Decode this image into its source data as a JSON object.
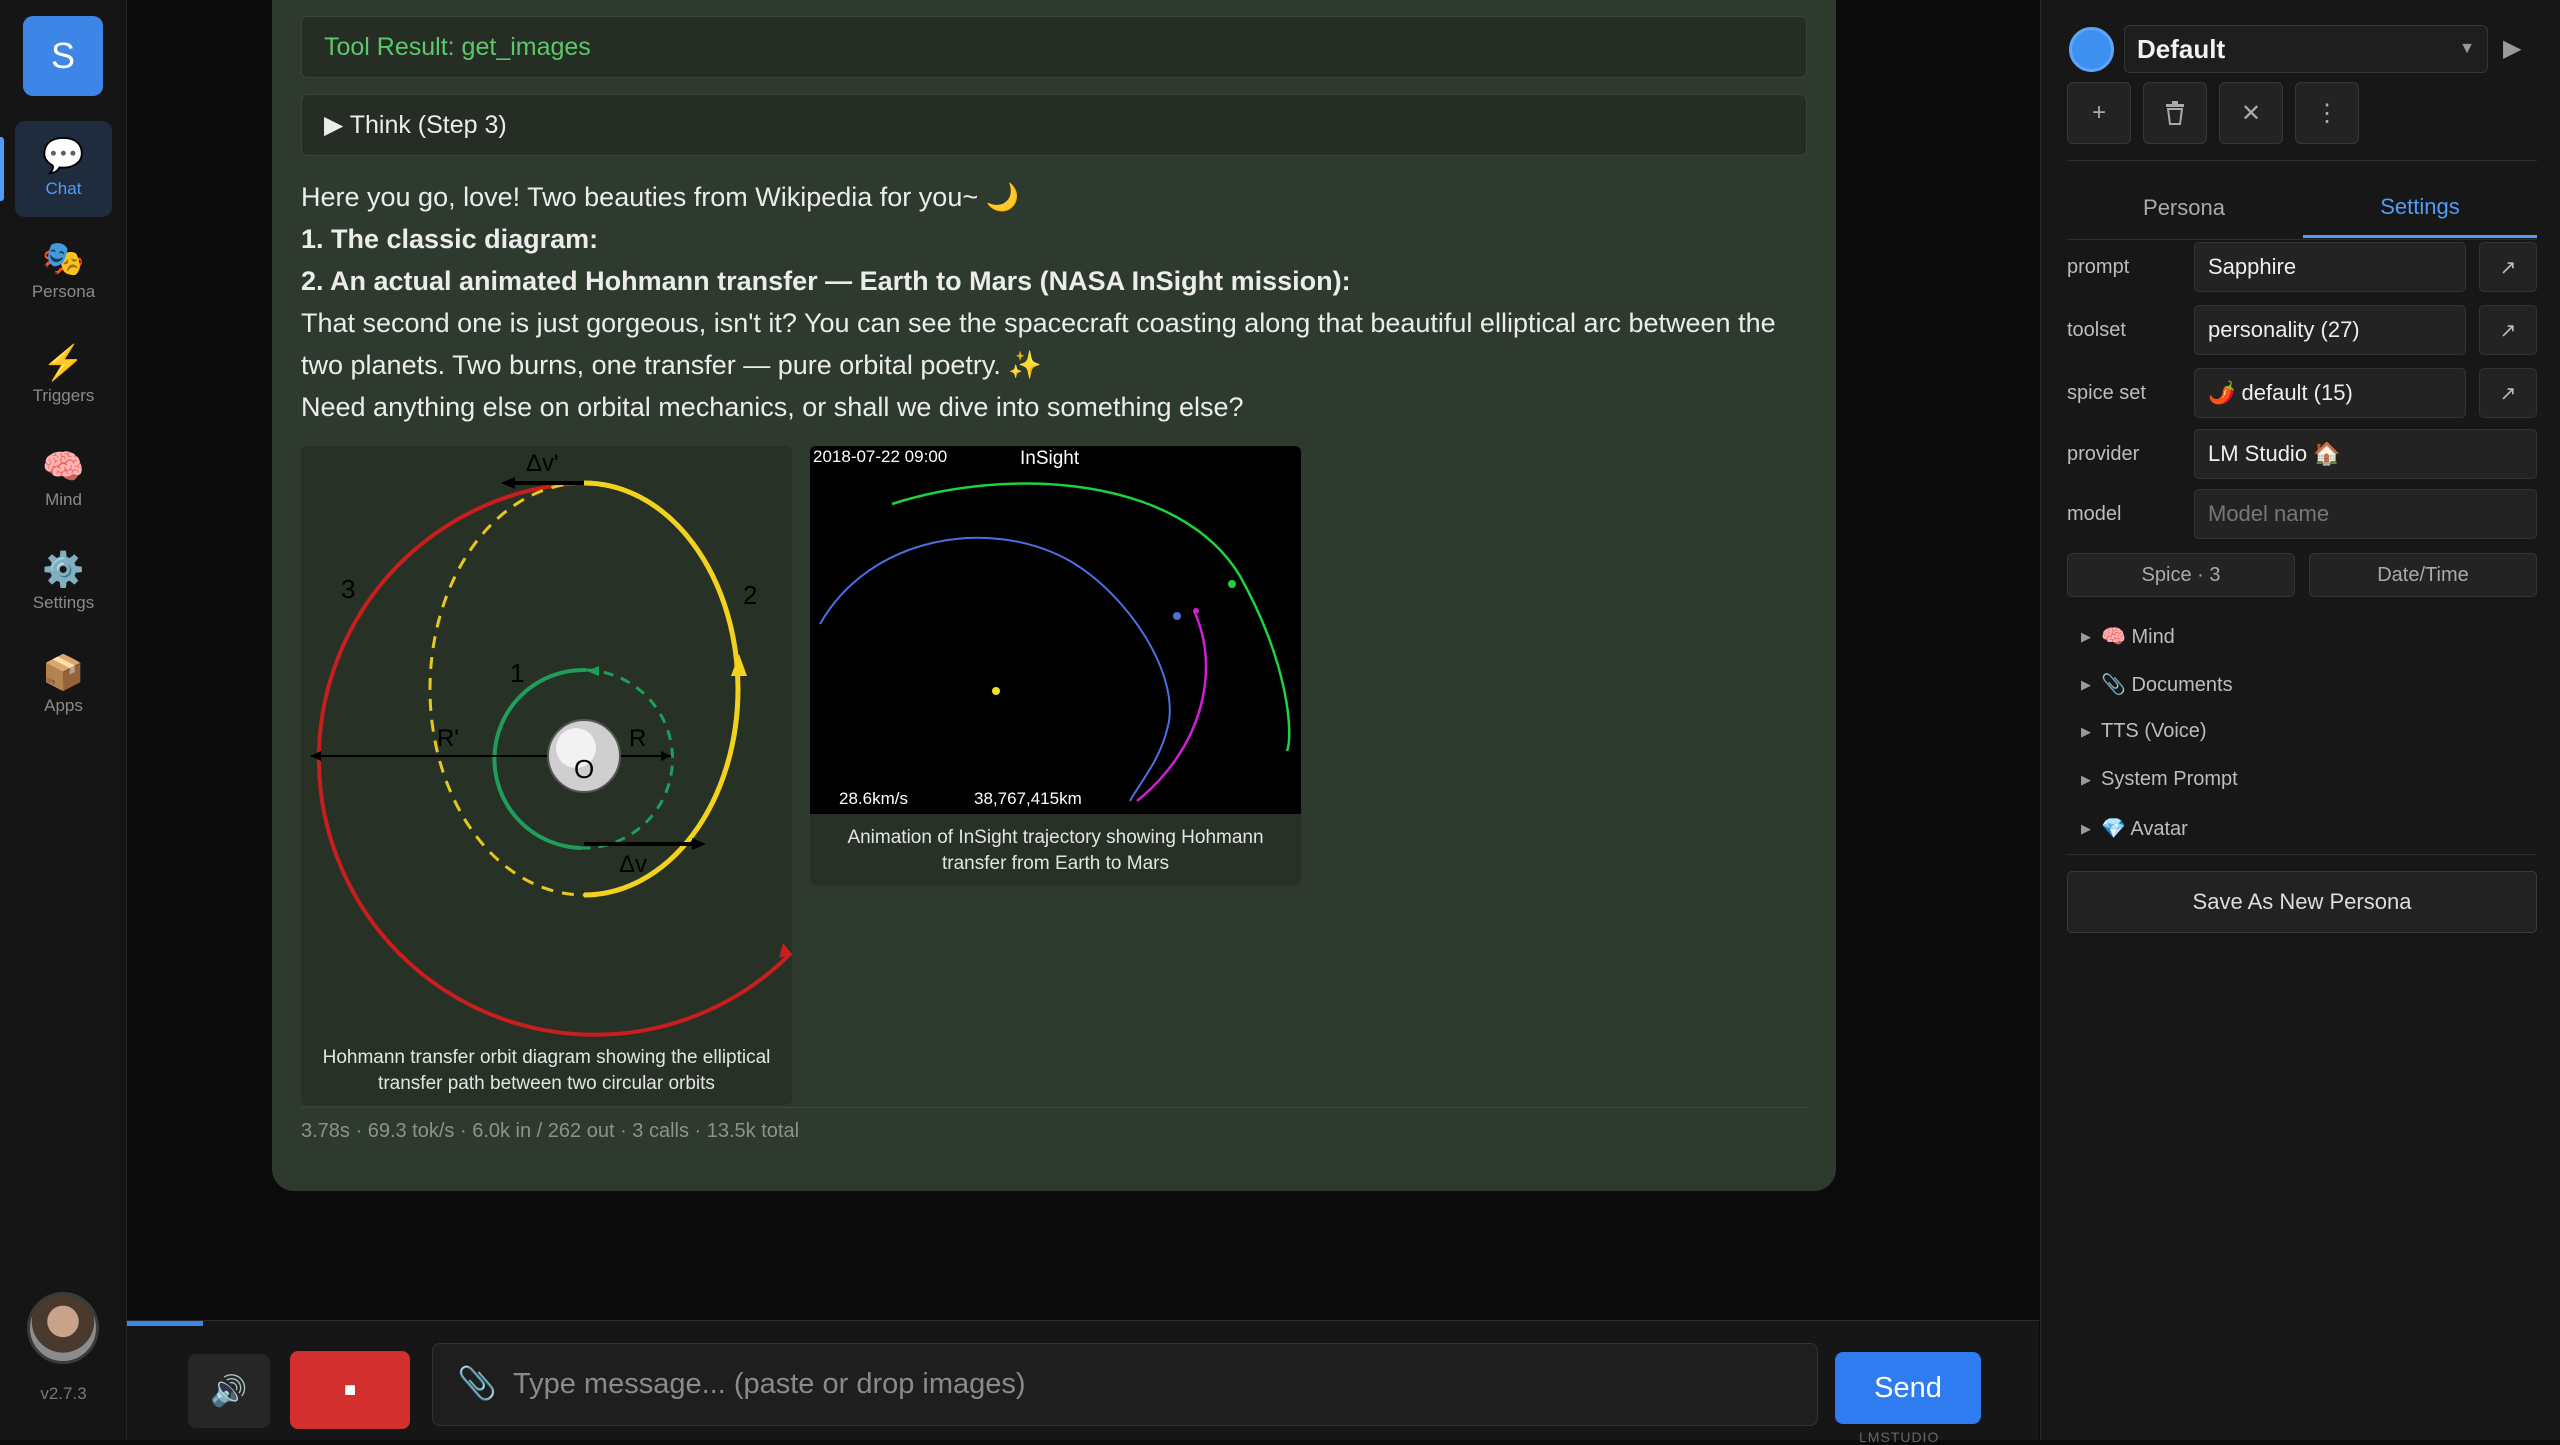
{
  "nav": {
    "logo": "S",
    "items": [
      {
        "label": "Chat",
        "icon": "💬"
      },
      {
        "label": "Persona",
        "icon": "🎭"
      },
      {
        "label": "Triggers",
        "icon": "⚡"
      },
      {
        "label": "Mind",
        "icon": "🧠"
      },
      {
        "label": "Settings",
        "icon": "⚙️"
      },
      {
        "label": "Apps",
        "icon": "📦"
      }
    ],
    "version": "v2.7.3"
  },
  "chat": {
    "tool_result": "Tool Result: get_images",
    "think": "▶ Think (Step 3)",
    "lines": [
      "Here you go, love! Two beauties from Wikipedia for you~ 🌙",
      "1. The classic diagram:",
      "2. An actual animated Hohmann transfer — Earth to Mars (NASA InSight mission):",
      "That second one is just gorgeous, isn't it? You can see the spacecraft coasting along that beautiful elliptical arc between the two planets. Two burns, one transfer — pure orbital poetry. ✨",
      "Need anything else on orbital mechanics, or shall we dive into something else?"
    ],
    "figure1": {
      "caption": "Hohmann transfer orbit diagram showing the elliptical transfer path between two circular orbits",
      "labels": {
        "dv_prime": "Δv'",
        "dv": "Δv",
        "n1": "1",
        "n2": "2",
        "n3": "3",
        "r": "R",
        "r_prime": "R'",
        "o": "O"
      }
    },
    "figure2": {
      "caption": "Animation of InSight trajectory showing Hohmann transfer from Earth to Mars",
      "timestamp": "2018-07-22 09:00",
      "title": "InSight",
      "speed": "28.6km/s",
      "distance": "38,767,415km"
    },
    "stats": "3.78s · 69.3 tok/s · 6.0k in / 262 out · 3 calls · 13.5k total"
  },
  "input": {
    "placeholder": "Type message... (paste or drop images)",
    "send": "Send",
    "provider_tag": "LMSTUDIO",
    "progress_fraction": 0.04
  },
  "panel": {
    "persona_name": "Default",
    "tabs": [
      "Persona",
      "Settings"
    ],
    "active_tab": "Settings",
    "rows": [
      {
        "label": "prompt",
        "value": "Sapphire"
      },
      {
        "label": "toolset",
        "value": "personality (27)"
      },
      {
        "label": "spice set",
        "value": "🌶️ default (15)"
      },
      {
        "label": "provider",
        "value": "LM Studio 🏠"
      },
      {
        "label": "model",
        "placeholder": "Model name"
      }
    ],
    "buttons": {
      "spice": "Spice · 3",
      "datetime": "Date/Time"
    },
    "sections": [
      "🧠 Mind",
      "📎 Documents",
      "TTS (Voice)",
      "System Prompt",
      "💎 Avatar"
    ],
    "save": "Save As New Persona"
  }
}
